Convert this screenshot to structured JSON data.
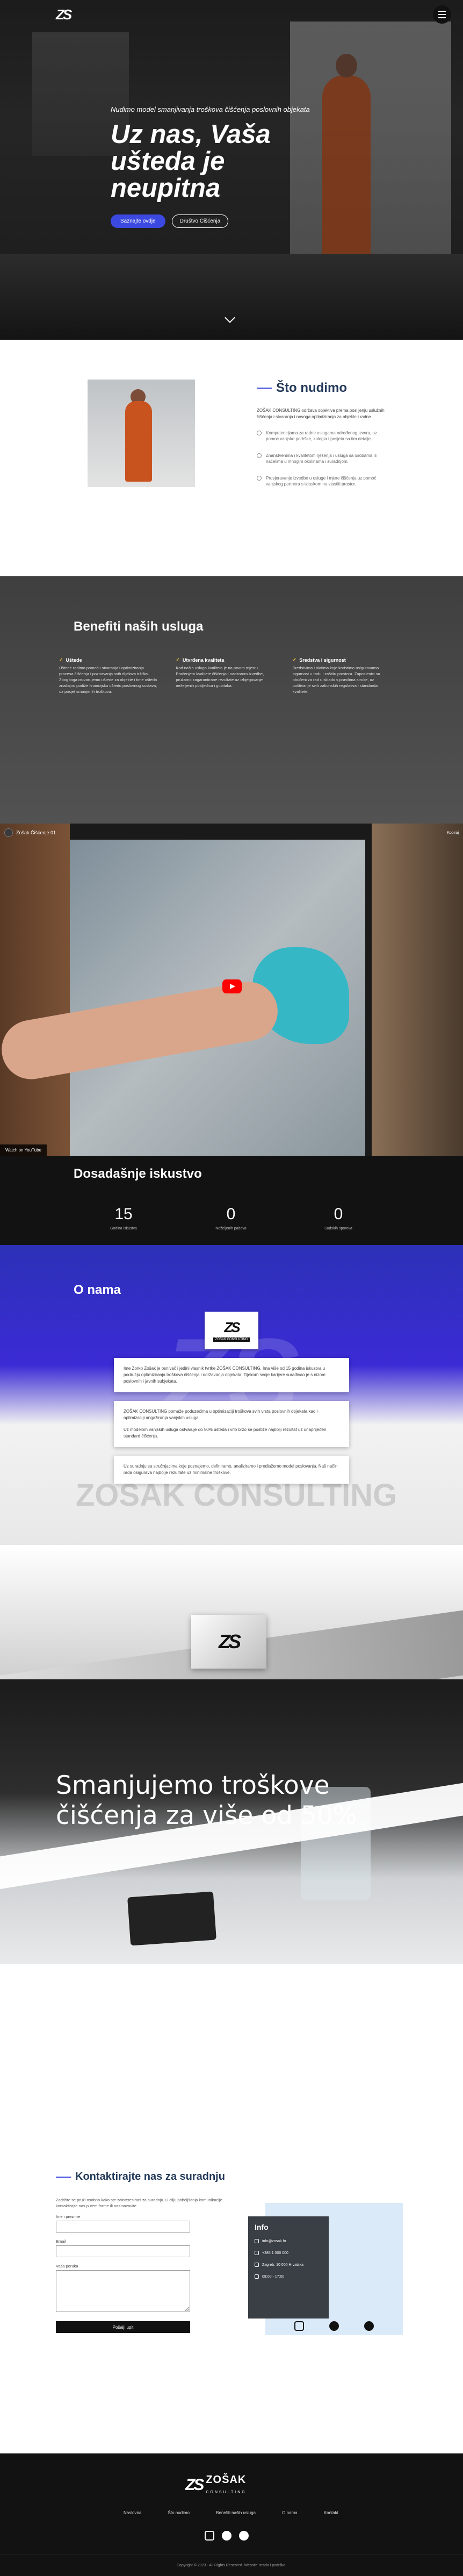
{
  "header": {
    "logo_text": "ZS",
    "menu_label": "menu"
  },
  "hero": {
    "kicker": "Nudimo model smanjivanja troškova čišćenja poslovnih objekata",
    "title": "Uz nas, Vaša ušteda je neupitna",
    "btn_primary": "Saznajte ovdje",
    "btn_secondary": "Društvo Čišćenja"
  },
  "whatwedo": {
    "title": "Što nudimo",
    "intro": "ZOŠAK CONSULTING održava objektiva prema poslijenju uslužnih čišćenja i stvaranja i novoga optimiziranja za objekte i radne.",
    "items": [
      "Kompetencijama za radne uslugama određenog izvora, uz pomoć vanjske podrške, kolegia i posjeta sa tim detalje.",
      "Znanstvenima i kvalitetom rješenja i usluga sa osobama ili načelima u mnogim okolinama i suradnjom.",
      "Provjeravanje izvedbe u usluge i mjere čišćenja uz pomoć vanjskog partnera s izlaskom na vlastiti prostor."
    ]
  },
  "benefits": {
    "title": "Benefiti naših usluga",
    "cols": [
      {
        "title": "Uštede",
        "text": "Uštede radimo pomoću stvaranja i optimiziranja procesa čišćenja i poznavanja svih dijelova tržišta. Zbog toga ostvarujemo uštede za objekte i time ušteda značajno podiže financijsku uštedu poslovnog sustava, uz posjet smanjenih troškova."
      },
      {
        "title": "Utvrđena kvaliteta",
        "text": "Kod naših usluga kvaliteta je na prvom mjestu. Praćenjem kvalitete čišćenja i nadzorom izvedbe, pružamo zagarantirane rezultate uz izbjegavanje neželjenih posljedica i gubitaka."
      },
      {
        "title": "Sredstva i sigurnost",
        "text": "Sredstvima i alatima koje koristimo osiguravamo sigurnost u radu i zaštitu prostora. Zaposlenici su obučeni za rad u skladu s pravilima struke, uz poštivanje svih zakonskih regulativa i standarda kvalitete."
      }
    ]
  },
  "video": {
    "channel_title": "Zošak Čišćenje 01",
    "share_label": "Kopiraj",
    "watch_on": "Watch on YouTube"
  },
  "experience": {
    "title": "Dosadašnje iskustvo",
    "stats": [
      {
        "value": "15",
        "label": "Godina iskustva"
      },
      {
        "value": "0",
        "label": "Neželjenih padova"
      },
      {
        "value": "0",
        "label": "Sudskih sporova"
      }
    ]
  },
  "about": {
    "title": "O nama",
    "logo_sub": "ZOŠAK CONSULTING",
    "watermark": "ZOŠAK CONSULTING",
    "card1": "Ime Zorko Zošak je osnivač i jedini vlasnik tvrtke ZOŠAK CONSULTING. Ima više od 15 godina iskustva u području optimiziranja troškova čišćenja i održavanja objekata. Tijekom svoje karijere surađivao je s nizom poslovnih i javnih subjekata.",
    "card2_a": "ZOŠAK CONSULTING pomaže poduzećima u optimizaciji troškova svih vrsta poslovnih objekata kao i optimizaciji angažiranja vanjskih usluga.",
    "card2_b": "Uz modelom vanjskih usluga ostvaruje do 50% ušteda i vrlo brzo se postiže najbolji rezultat uz unaprijeđen standard čišćenja.",
    "card3": "Uz suradnju sa stručnjacima koje poznajemo, definiramo, analiziramo i predlažemo model poslovanja. Naš način rada osigurava najbolje rezultate uz minimalne troškove."
  },
  "band": {
    "title": "Smanjujemo troškove čišćenja za više od 50%"
  },
  "contact": {
    "title": "Kontaktirajte nas za suradnju",
    "desc": "Zadržite se pruži osobno kako ste zainteresirani za suradnju. U cilju poboljšanja komunikacije kontaktirajte nas putem forme ili nas nazovite.",
    "label_name": "Ime i prezime",
    "label_email": "Email",
    "label_message": "Vaša poruka",
    "send": "Pošalji upit",
    "info_title": "Info",
    "info_email": "info@zosak.hr",
    "info_phone": "+385 1 000 000",
    "info_address": "Zagreb, 10 000 Hrvatska",
    "info_hours": "08:00 - 17:00"
  },
  "footer": {
    "logo_text": "ZOŠAK",
    "logo_sub": "CONSULTING",
    "nav": [
      "Naslovna",
      "Što nudimo",
      "Benefiti naših usluga",
      "O nama",
      "Kontakt"
    ],
    "copyright": "Copyright © 2023 - All Rights Reserved. Website izrada i podrška."
  }
}
